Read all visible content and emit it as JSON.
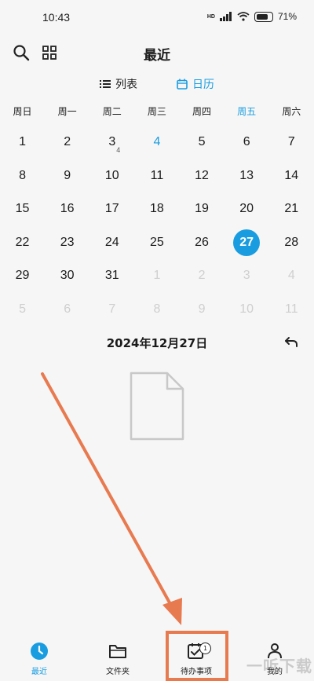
{
  "status": {
    "time": "10:43",
    "network": "HD",
    "battery": "71%"
  },
  "header": {
    "title": "最近"
  },
  "view_toggle": {
    "list_label": "列表",
    "calendar_label": "日历",
    "active": "calendar"
  },
  "calendar": {
    "weekdays": [
      "周日",
      "周一",
      "周二",
      "周三",
      "周四",
      "周五",
      "周六"
    ],
    "highlight_weekday": "周五",
    "days": [
      {
        "d": "1"
      },
      {
        "d": "2"
      },
      {
        "d": "3",
        "sub": "4"
      },
      {
        "d": "4",
        "blue": true
      },
      {
        "d": "5"
      },
      {
        "d": "6"
      },
      {
        "d": "7"
      },
      {
        "d": "8"
      },
      {
        "d": "9"
      },
      {
        "d": "10"
      },
      {
        "d": "11"
      },
      {
        "d": "12"
      },
      {
        "d": "13"
      },
      {
        "d": "14"
      },
      {
        "d": "15"
      },
      {
        "d": "16"
      },
      {
        "d": "17"
      },
      {
        "d": "18"
      },
      {
        "d": "19"
      },
      {
        "d": "20"
      },
      {
        "d": "21"
      },
      {
        "d": "22"
      },
      {
        "d": "23"
      },
      {
        "d": "24"
      },
      {
        "d": "25"
      },
      {
        "d": "26"
      },
      {
        "d": "27",
        "selected": true
      },
      {
        "d": "28"
      },
      {
        "d": "29"
      },
      {
        "d": "30"
      },
      {
        "d": "31"
      },
      {
        "d": "1",
        "dim": true
      },
      {
        "d": "2",
        "dim": true
      },
      {
        "d": "3",
        "dim": true
      },
      {
        "d": "4",
        "dim": true
      },
      {
        "d": "5",
        "dim": true
      },
      {
        "d": "6",
        "dim": true
      },
      {
        "d": "7",
        "dim": true
      },
      {
        "d": "8",
        "dim": true
      },
      {
        "d": "9",
        "dim": true
      },
      {
        "d": "10",
        "dim": true
      },
      {
        "d": "11",
        "dim": true
      }
    ]
  },
  "selected_date": "2024年12月27日",
  "nav": {
    "items": [
      {
        "label": "最近",
        "icon": "clock-icon",
        "active": true
      },
      {
        "label": "文件夹",
        "icon": "folder-icon"
      },
      {
        "label": "待办事项",
        "icon": "calendar-check-icon",
        "badge": "1"
      },
      {
        "label": "我的",
        "icon": "person-icon"
      }
    ]
  },
  "watermark": "一听下载",
  "colors": {
    "accent": "#1a9de0",
    "annotation": "#e87a50"
  }
}
